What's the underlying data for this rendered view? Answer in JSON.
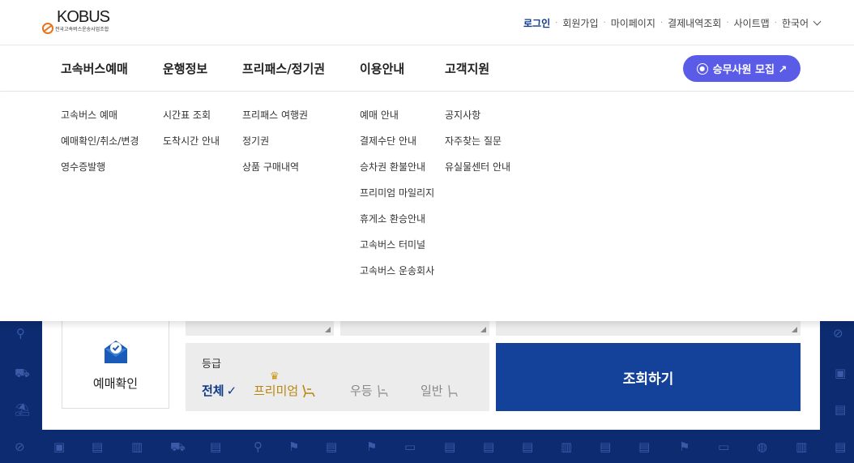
{
  "logo": {
    "text": "KOBUS",
    "subtitle": "전국고속버스운송사업조합"
  },
  "util_nav": {
    "login": "로그인",
    "signup": "회원가입",
    "mypage": "마이페이지",
    "payment_history": "결제내역조회",
    "sitemap": "사이트맵",
    "language": "한국어"
  },
  "main_nav": [
    {
      "label": "고속버스예매"
    },
    {
      "label": "운행정보"
    },
    {
      "label": "프리패스/정기권"
    },
    {
      "label": "이용안내"
    },
    {
      "label": "고객지원"
    }
  ],
  "recruit_button": "승무사원 모집 ↗",
  "dropdown": {
    "col1": [
      "고속버스 예매",
      "예매확인/취소/변경",
      "영수증발행"
    ],
    "col2": [
      "시간표 조회",
      "도착시간 안내"
    ],
    "col3": [
      "프리패스 여행권",
      "정기권",
      "상품 구매내역"
    ],
    "col4": [
      "예매 안내",
      "결제수단 안내",
      "승차권 환불안내",
      "프리미엄 마일리지",
      "휴게소 환승안내",
      "고속버스 터미널",
      "고속버스 운송회사"
    ],
    "col5": [
      "공지사항",
      "자주찾는 질문",
      "유실물센터 안내"
    ]
  },
  "reservation_check": "예매확인",
  "grade": {
    "title": "등급",
    "all": "전체",
    "all_check": "✓",
    "premium": "프리미엄",
    "wudeung": "우등",
    "ilban": "일반"
  },
  "search_button": "조회하기",
  "colors": {
    "brand": "#14429a",
    "recruit": "#5a5ce8",
    "background": "#0d2b70",
    "premium": "#b8860b"
  },
  "background_icons": [
    "pin-icon",
    "car-icon",
    "beach-icon",
    "compass-icon",
    "bag-icon",
    "bus-icon",
    "flag-icon",
    "map-icon",
    "card-icon",
    "globe-icon"
  ]
}
